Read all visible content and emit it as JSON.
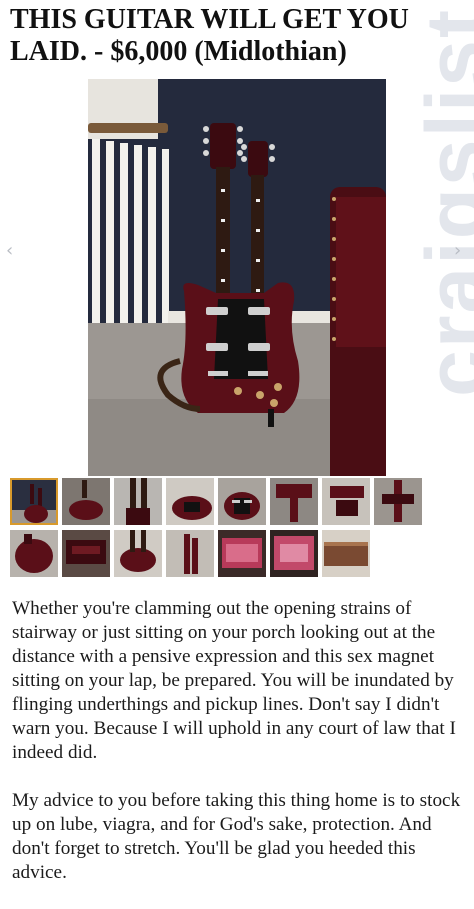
{
  "listing": {
    "title": "THIS GUITAR WILL GET YOU LAID. - $6,000 (Midlothian)"
  },
  "watermark": {
    "text": "craigslist"
  },
  "gallery": {
    "prev_icon": "‹",
    "next_icon": "›",
    "thumb_count": 15,
    "active_thumb": 1
  },
  "description": {
    "paragraphs": [
      "Whether you're clamming out the opening strains of stairway or just sitting on your porch looking out at the distance with a pensive expression and this sex magnet sitting on your lap, be prepared. You will be inundated by flinging underthings and pickup lines. Don't say I didn't warn you. Because I will uphold in any court of law that I indeed did.",
      "My advice to you before taking this thing home is to stock up on lube, viagra, and for God's sake, protection. And don't forget to stretch. You'll be glad you heeded this advice."
    ]
  },
  "colors": {
    "guitar": "#5a0f18",
    "wall": "#242a3d",
    "carpet": "#9c9792",
    "thumb_active_border": "#d89a2c"
  }
}
